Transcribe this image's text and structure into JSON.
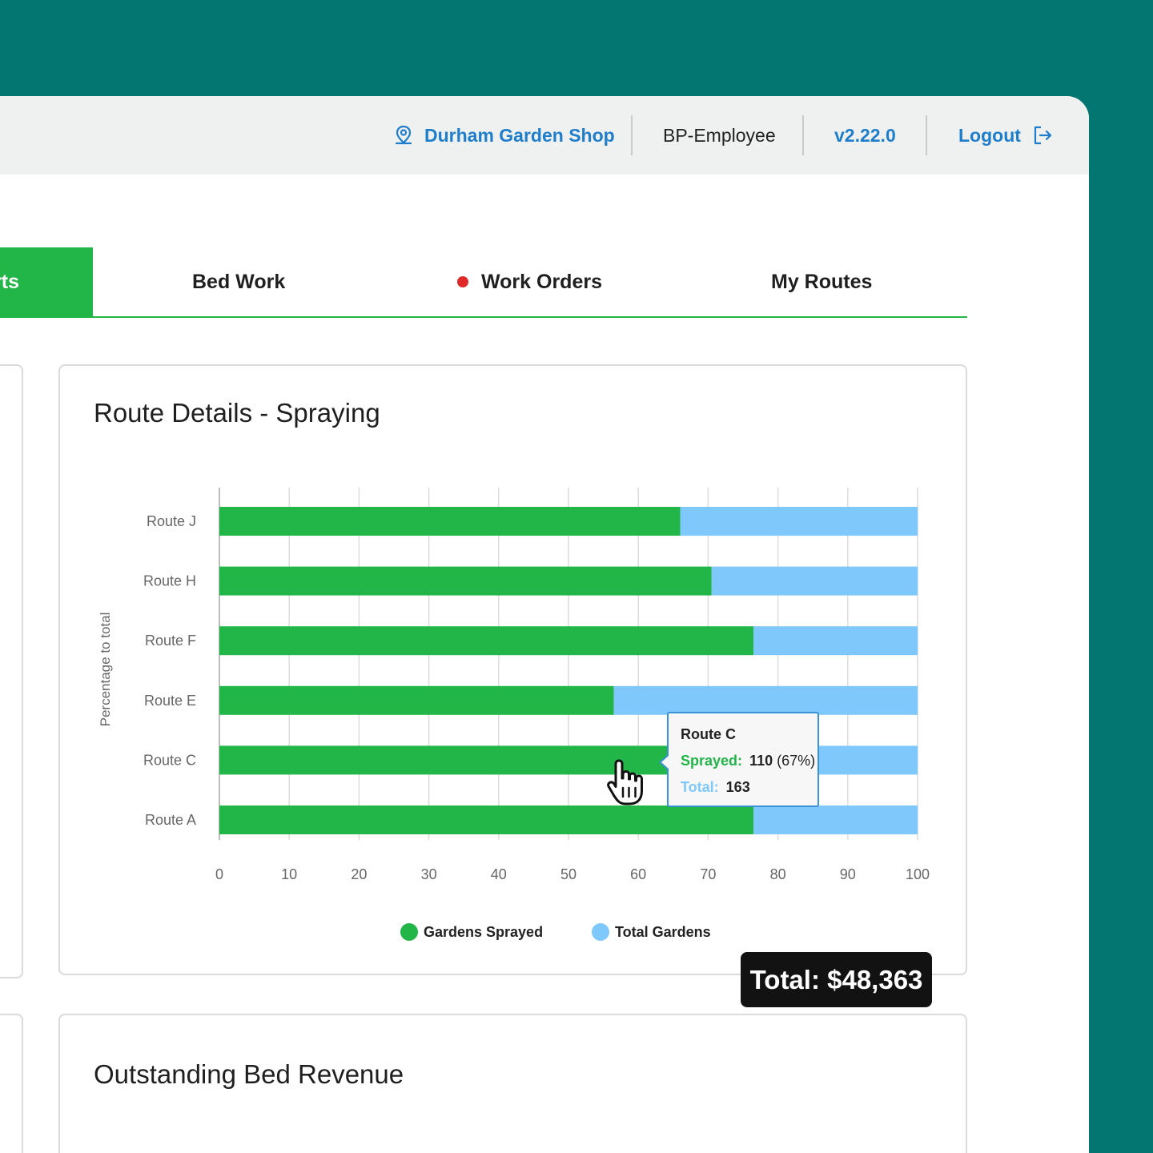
{
  "header": {
    "location": "Durham Garden Shop",
    "role": "BP-Employee",
    "version": "v2.22.0",
    "logout": "Logout",
    "location_icon": "map-pin-person-icon",
    "logout_icon": "logout-arrow-icon"
  },
  "tabs": {
    "active_partial": "rts",
    "items": [
      {
        "label": "Bed Work"
      },
      {
        "label": "Work Orders",
        "has_alert_dot": true
      },
      {
        "label": "My Routes"
      }
    ]
  },
  "route_card": {
    "title": "Route Details - Spraying"
  },
  "revenue_card": {
    "title": "Outstanding Bed Revenue",
    "total": "Total: $48,363"
  },
  "tooltip": {
    "title": "Route C",
    "sprayed_label": "Sprayed:",
    "sprayed_value": "110",
    "sprayed_pct": "(67%)",
    "total_label": "Total:",
    "total_value": "163"
  },
  "colors": {
    "sprayed": "#22b548",
    "total": "#7fc8fc",
    "accent": "#22b548",
    "link": "#1f7ecb",
    "background": "#037672"
  },
  "chart_data": {
    "type": "bar",
    "orientation": "horizontal",
    "stacked": true,
    "categories": [
      "Route J",
      "Route H",
      "Route F",
      "Route E",
      "Route C",
      "Route A"
    ],
    "series": [
      {
        "name": "Gardens Sprayed",
        "values": [
          66,
          70.5,
          76.5,
          56.5,
          67,
          76.5
        ]
      },
      {
        "name": "Total Gardens",
        "values": [
          34,
          29.5,
          23.5,
          43.5,
          33,
          23.5
        ]
      }
    ],
    "ylabel": "Percentage to total",
    "xlim": [
      0,
      100
    ],
    "xticks": [
      "0",
      "10",
      "20",
      "30",
      "40",
      "50",
      "60",
      "70",
      "80",
      "90",
      "100"
    ],
    "grid": true,
    "legend": "bottom"
  }
}
